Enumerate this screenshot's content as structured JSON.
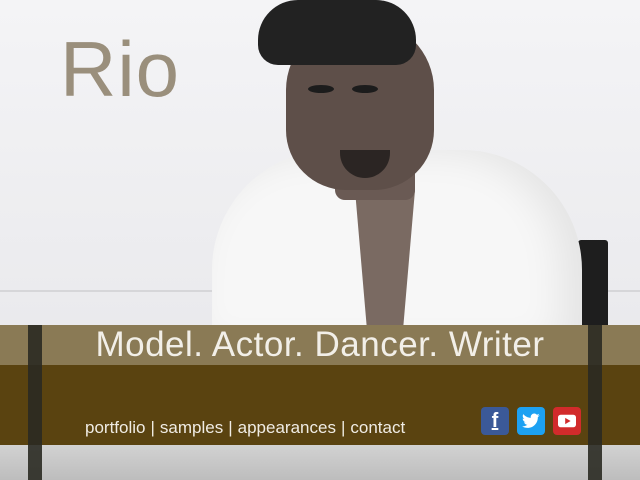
{
  "site": {
    "logo": "Rio",
    "tagline": "Model. Actor. Dancer. Writer"
  },
  "nav": {
    "items": [
      "portfolio",
      "samples",
      "appearances",
      "contact"
    ],
    "separator": "|"
  },
  "social": {
    "icons": [
      "facebook-icon",
      "twitter-icon",
      "youtube-icon"
    ]
  },
  "colors": {
    "logo": "#9a8f7c",
    "tagline_band": "#8a7a55",
    "nav_band": "#5a4310",
    "facebook": "#3b5998",
    "twitter": "#1da1f2",
    "youtube": "#d22b2b"
  }
}
